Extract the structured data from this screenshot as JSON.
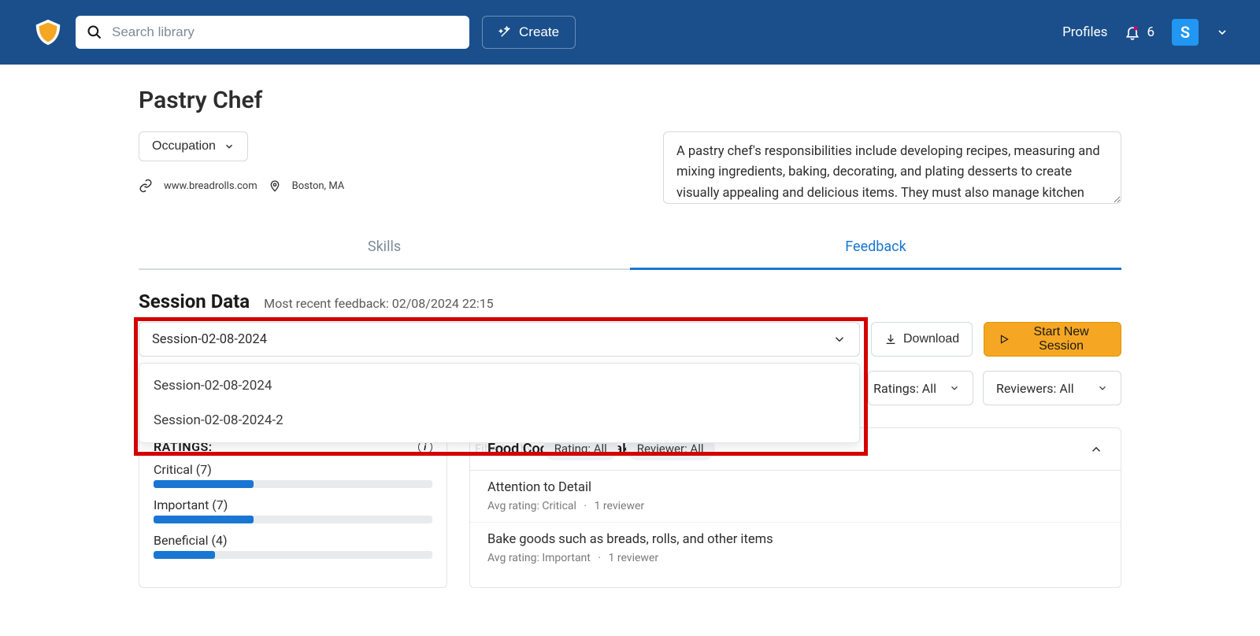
{
  "nav": {
    "search_placeholder": "Search library",
    "create_label": "Create",
    "profiles_label": "Profiles",
    "notification_count": "6",
    "avatar_initial": "S"
  },
  "page": {
    "title": "Pastry Chef",
    "occupation_label": "Occupation",
    "website": "www.breadrolls.com",
    "location": "Boston, MA",
    "description": "A pastry chef's responsibilities include developing recipes, measuring and mixing ingredients, baking, decorating, and plating desserts to create visually appealing and delicious items. They must also manage kitchen"
  },
  "tabs": {
    "skills": "Skills",
    "feedback": "Feedback"
  },
  "session": {
    "heading": "Session Data",
    "recent_label": "Most recent feedback: 02/08/2024 22:15",
    "selected": "Session-02-08-2024",
    "options": [
      "Session-02-08-2024",
      "Session-02-08-2024-2"
    ],
    "download_label": "Download",
    "start_label": "Start New Session"
  },
  "filters": {
    "ratings_label": "Ratings: All",
    "reviewers_label": "Reviewers: All",
    "filtering_by_label": "Filtering by:",
    "pill_rating": "Rating: All",
    "pill_reviewer": "Reviewer: All"
  },
  "ratings": {
    "heading": "RATINGS:",
    "items": [
      {
        "label": "Critical (7)",
        "pct": 36
      },
      {
        "label": "Important (7)",
        "pct": 36
      },
      {
        "label": "Beneficial (4)",
        "pct": 22
      }
    ]
  },
  "skill_group": {
    "title": "Food Cooking and Baking",
    "items": [
      {
        "name": "Attention to Detail",
        "avg": "Avg rating: Critical",
        "reviewers": "1 reviewer"
      },
      {
        "name": "Bake goods such as breads, rolls, and other items",
        "avg": "Avg rating: Important",
        "reviewers": "1 reviewer"
      }
    ]
  }
}
